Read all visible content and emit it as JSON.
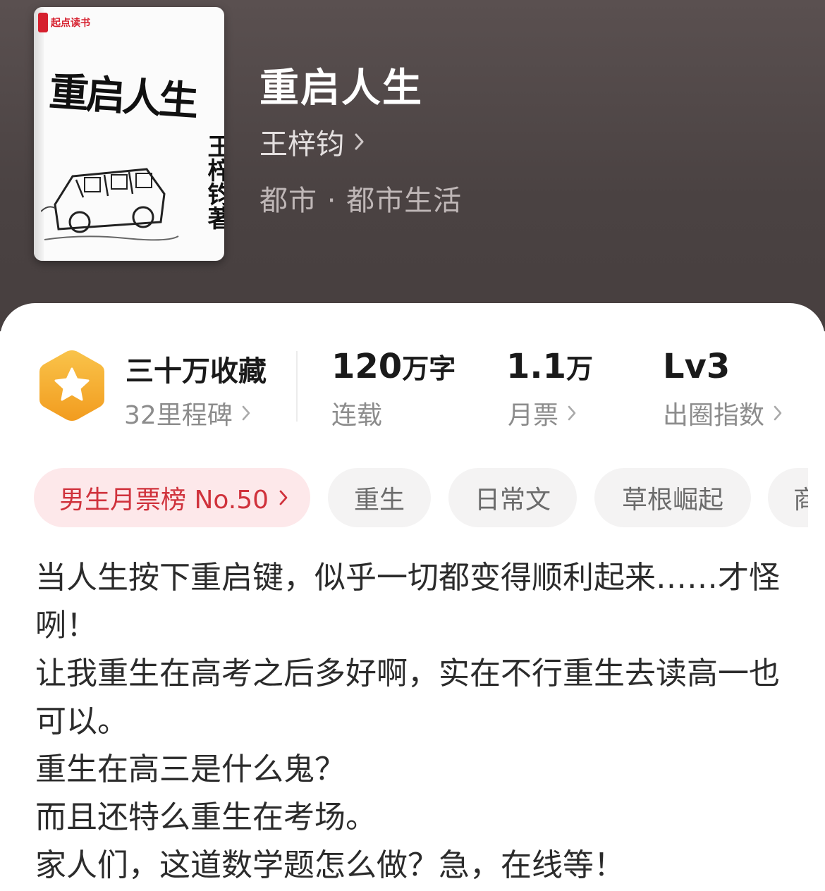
{
  "book": {
    "title": "重启人生",
    "author": "王梓钧",
    "genre": "都市 · 都市生活",
    "cover": {
      "publisher_logo": "起点读书",
      "cover_title": "重启人生",
      "cover_author": "王梓钧著"
    }
  },
  "stats": {
    "collection": {
      "main": "三十万收藏",
      "sub": "32里程碑"
    },
    "words": {
      "number": "120",
      "unit": "万字",
      "sub": "连载"
    },
    "monthly_tickets": {
      "number": "1.1",
      "unit": "万",
      "sub": "月票"
    },
    "influence": {
      "main": "Lv3",
      "sub": "出圈指数"
    }
  },
  "tags": {
    "rank": "男生月票榜 No.50",
    "items": [
      "重生",
      "日常文",
      "草根崛起",
      "商"
    ]
  },
  "synopsis": [
    "当人生按下重启键，似乎一切都变得顺利起来……才怪咧！",
    "让我重生在高考之后多好啊，实在不行重生去读高一也可以。",
    "重生在高三是什么鬼？",
    "而且还特么重生在考场。",
    "家人们，这道数学题怎么做？急，在线等！"
  ],
  "colors": {
    "hero_bg": "#4d4545",
    "rank_tag_text": "#d0323c",
    "rank_tag_bg": "#fde8ea",
    "badge_gold": "#f5b32e"
  },
  "icons": {
    "badge": "star-hexagon-icon",
    "chevron": "chevron-right-icon"
  }
}
